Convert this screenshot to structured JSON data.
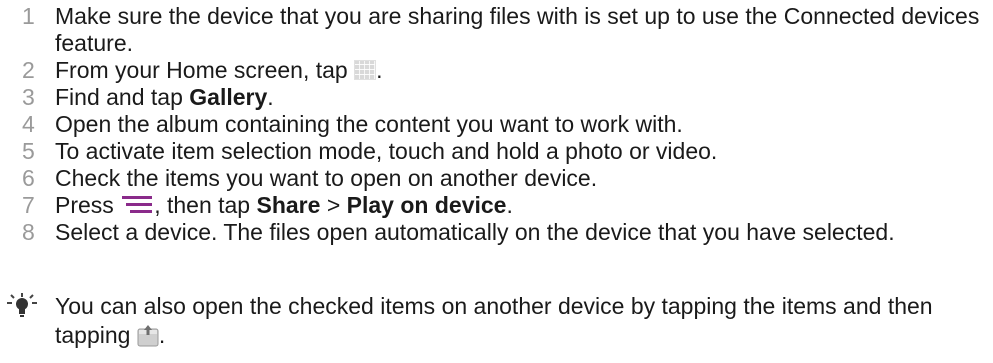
{
  "steps": [
    {
      "num": "1",
      "text": "Make sure the device that you are sharing files with is set up to use the Connected devices feature."
    },
    {
      "num": "2",
      "text_before": "From your Home screen, tap ",
      "text_after": ".",
      "icon": "apps-grid-icon"
    },
    {
      "num": "3",
      "text_before": "Find and tap ",
      "bold": "Gallery",
      "text_after": "."
    },
    {
      "num": "4",
      "text": "Open the album containing the content you want to work with."
    },
    {
      "num": "5",
      "text": "To activate item selection mode, touch and hold a photo or video."
    },
    {
      "num": "6",
      "text": "Check the items you want to open on another device."
    },
    {
      "num": "7",
      "text_before": "Press ",
      "text_mid": ", then tap ",
      "bold1": "Share",
      "sep": " > ",
      "bold2": "Play on device",
      "text_after": ".",
      "icon": "menu-icon"
    },
    {
      "num": "8",
      "text": "Select a device. The files open automatically on the device that you have selected."
    }
  ],
  "tip": {
    "icon": "lightbulb-icon",
    "text_before": "You can also open the checked items on another device by tapping the items and then tapping ",
    "text_after": ".",
    "trailing_icon": "share-icon"
  },
  "colors": {
    "step_number": "#9a9a9a",
    "text": "#1a1a1a",
    "menu_icon": "#8a2a8a"
  }
}
